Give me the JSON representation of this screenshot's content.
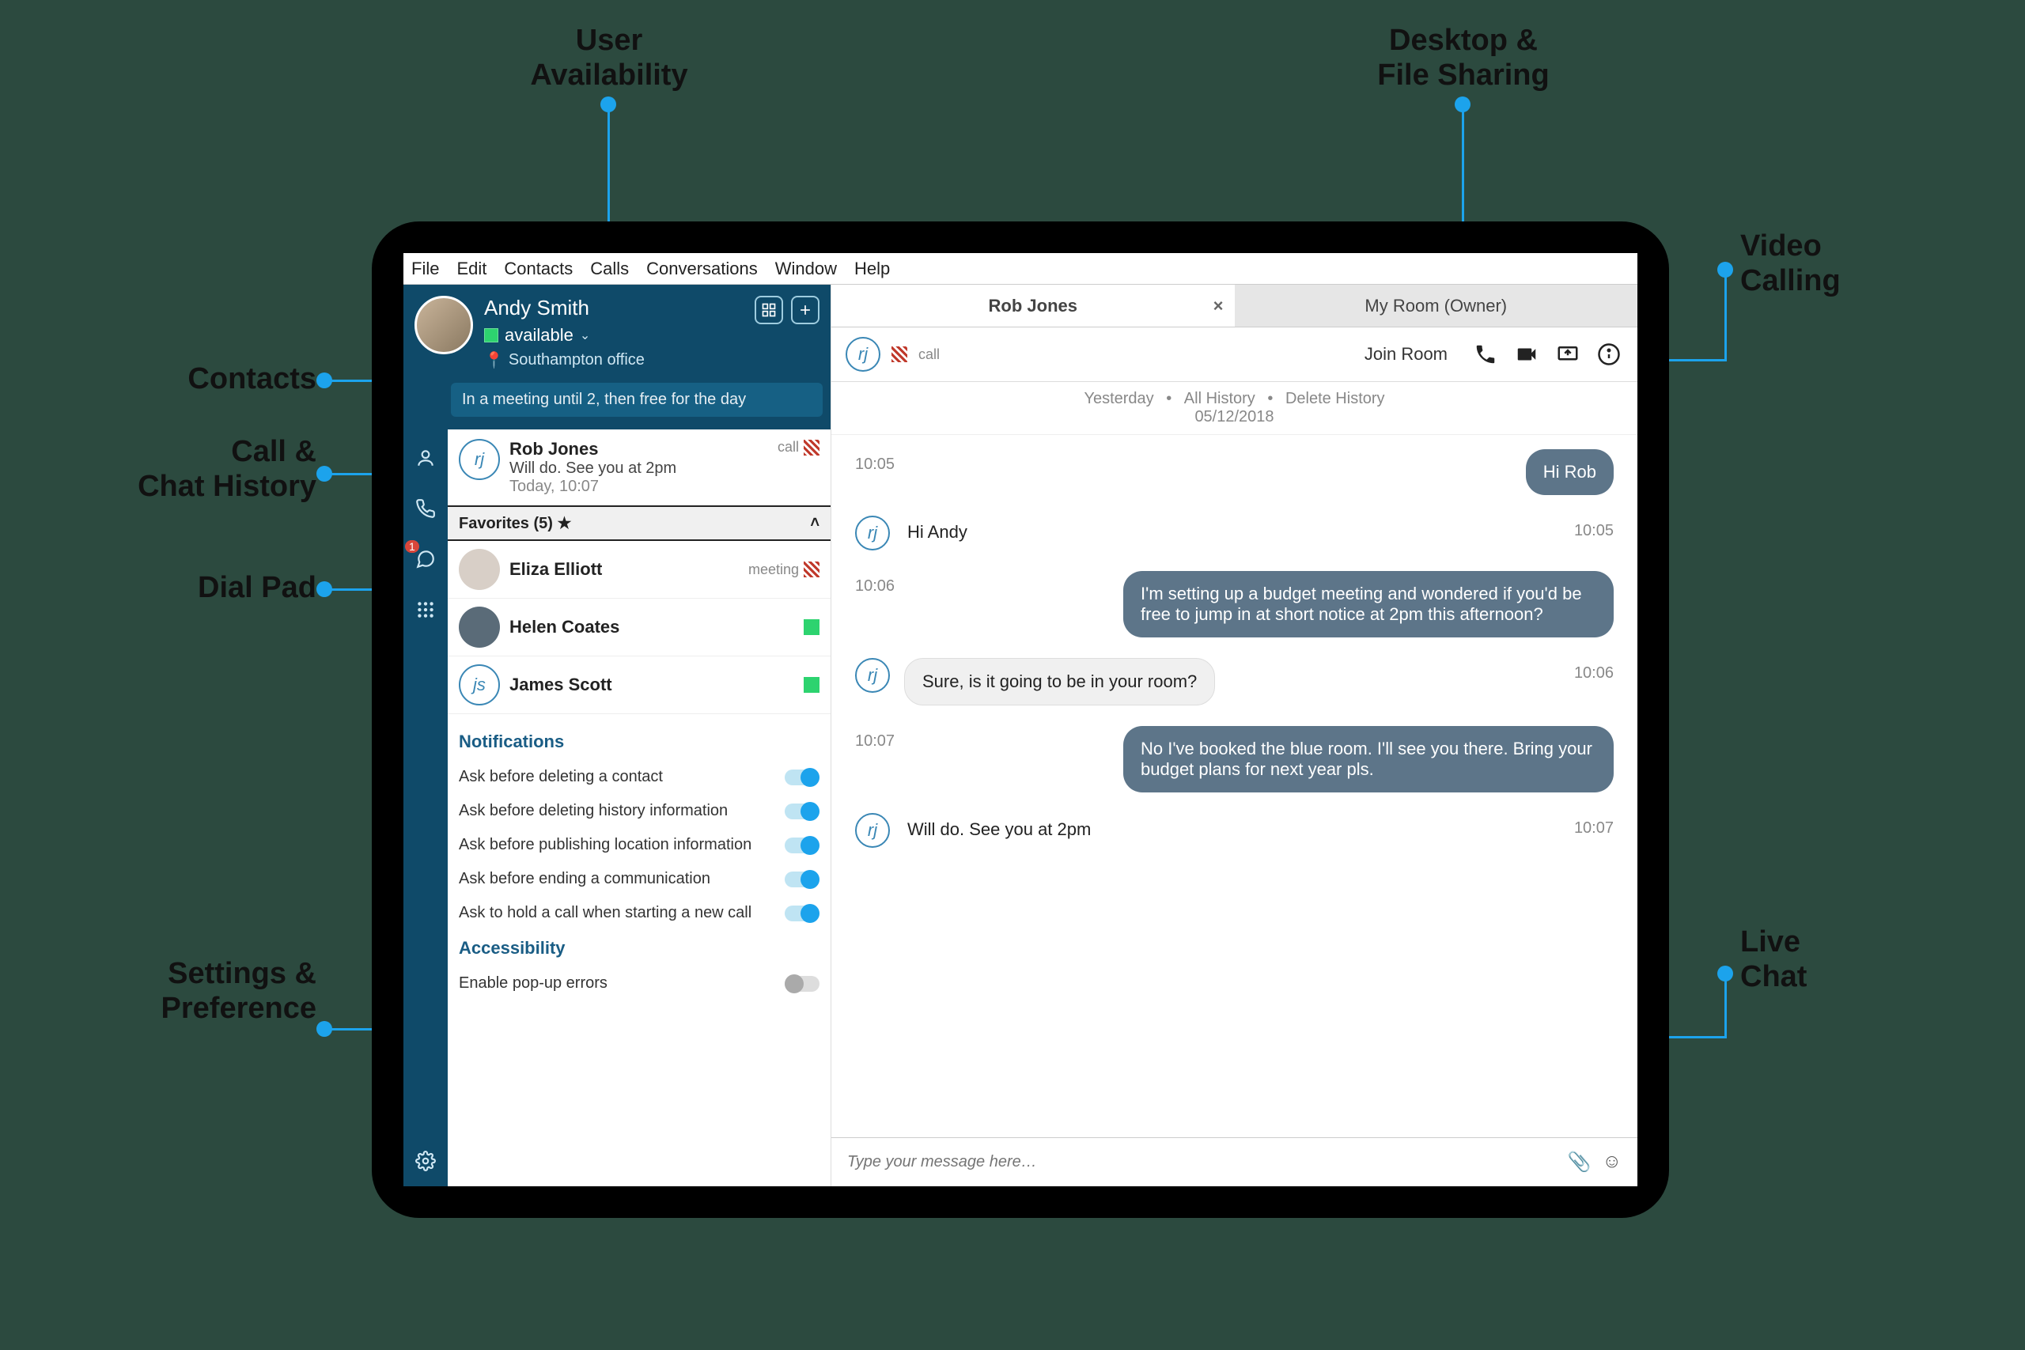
{
  "annotations": {
    "user_availability": "User\nAvailability",
    "desktop_file_sharing": "Desktop &\nFile Sharing",
    "video_calling": "Video\nCalling",
    "live_chat": "Live\nChat",
    "contacts": "Contacts",
    "call_chat_history": "Call &\nChat History",
    "dial_pad": "Dial Pad",
    "settings_pref": "Settings &\nPreference"
  },
  "menubar": [
    "File",
    "Edit",
    "Contacts",
    "Calls",
    "Conversations",
    "Window",
    "Help"
  ],
  "profile": {
    "name": "Andy Smith",
    "status_label": "available",
    "location": "Southampton office",
    "status_message": "In a meeting until 2, then free for the day"
  },
  "recent": {
    "name": "Rob Jones",
    "preview": "Will do. See you at 2pm",
    "time": "Today, 10:07",
    "badge": "call"
  },
  "favorites": {
    "header": "Favorites (5) ★",
    "items": [
      {
        "name": "Eliza Elliott",
        "tag": "meeting",
        "tagstyle": "hatched"
      },
      {
        "name": "Helen Coates",
        "tagstyle": "green"
      },
      {
        "name": "James Scott",
        "initials": "js",
        "tagstyle": "green"
      }
    ]
  },
  "settings": {
    "notifications_header": "Notifications",
    "notif_items": [
      "Ask before deleting a contact",
      "Ask before deleting history information",
      "Ask before publishing location information",
      "Ask before ending a communication",
      "Ask to hold a call when starting a new call"
    ],
    "accessibility_header": "Accessibility",
    "access_items": [
      "Enable pop-up errors"
    ]
  },
  "chat": {
    "tabs": [
      {
        "label": "Rob Jones",
        "active": true
      },
      {
        "label": "My Room (Owner)",
        "active": false
      }
    ],
    "call_tag": "call",
    "join_label": "Join Room",
    "history_links": [
      "Yesterday",
      "All History",
      "Delete History"
    ],
    "history_date": "05/12/2018",
    "messages": [
      {
        "ts": "10:05",
        "side": "out",
        "text": "Hi Rob"
      },
      {
        "ts": "10:05",
        "side": "in",
        "avatar": "rj",
        "style": "plain",
        "text": "Hi Andy"
      },
      {
        "ts": "10:06",
        "side": "out",
        "text": "I'm setting up a budget meeting and wondered if you'd be free to jump in at short notice at 2pm this afternoon?"
      },
      {
        "ts": "10:06",
        "side": "in",
        "avatar": "rj",
        "style": "bub",
        "text": "Sure, is it going to be in your room?"
      },
      {
        "ts": "10:07",
        "side": "out",
        "text": "No I've booked the blue room. I'll see you there. Bring your budget plans for next year pls."
      },
      {
        "ts": "10:07",
        "side": "in",
        "avatar": "rj",
        "style": "plain",
        "text": "Will do. See you at 2pm"
      }
    ],
    "input_placeholder": "Type your message here…"
  },
  "iconrail_badge": "1"
}
